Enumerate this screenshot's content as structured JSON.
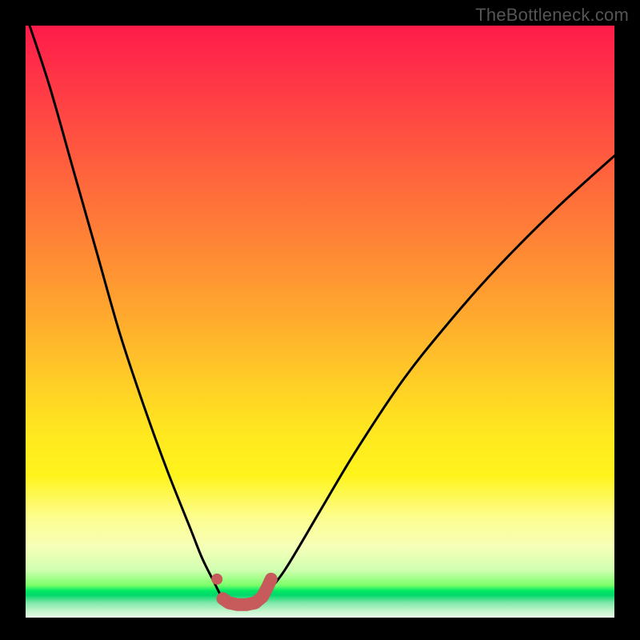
{
  "watermark": "TheBottleneck.com",
  "colors": {
    "page_bg": "#000000",
    "gradient_top": "#ff1b4a",
    "gradient_mid": "#ffe620",
    "gradient_green": "#00e862",
    "curve_stroke": "#000000",
    "marker_fill": "#c75a5a",
    "marker_stroke": "#c75a5a"
  },
  "chart_data": {
    "type": "line",
    "title": "",
    "xlabel": "",
    "ylabel": "",
    "xlim": [
      0,
      100
    ],
    "ylim": [
      0,
      100
    ],
    "annotations": [],
    "legend": [],
    "series": [
      {
        "name": "left-branch",
        "x": [
          0,
          4,
          8,
          12,
          16,
          20,
          24,
          28,
          30,
          32,
          33.5
        ],
        "y": [
          102,
          90,
          76,
          62,
          48,
          36,
          25,
          15,
          10,
          6,
          3
        ]
      },
      {
        "name": "right-branch",
        "x": [
          40,
          44,
          50,
          56,
          64,
          72,
          80,
          90,
          100
        ],
        "y": [
          3,
          8,
          18,
          28,
          40,
          50,
          59,
          69,
          78
        ]
      }
    ],
    "markers": {
      "name": "bottom-markers",
      "points": [
        {
          "x": 32.5,
          "y": 6.5,
          "r": 1.0
        },
        {
          "x": 33.5,
          "y": 3.2,
          "r": 1.3
        },
        {
          "x": 34.5,
          "y": 2.5,
          "r": 1.3
        },
        {
          "x": 36.0,
          "y": 2.2,
          "r": 1.3
        },
        {
          "x": 37.5,
          "y": 2.2,
          "r": 1.3
        },
        {
          "x": 39.0,
          "y": 2.5,
          "r": 1.3
        },
        {
          "x": 40.2,
          "y": 3.5,
          "r": 1.3
        },
        {
          "x": 41.0,
          "y": 5.0,
          "r": 1.3
        },
        {
          "x": 41.7,
          "y": 6.5,
          "r": 1.3
        }
      ]
    }
  }
}
